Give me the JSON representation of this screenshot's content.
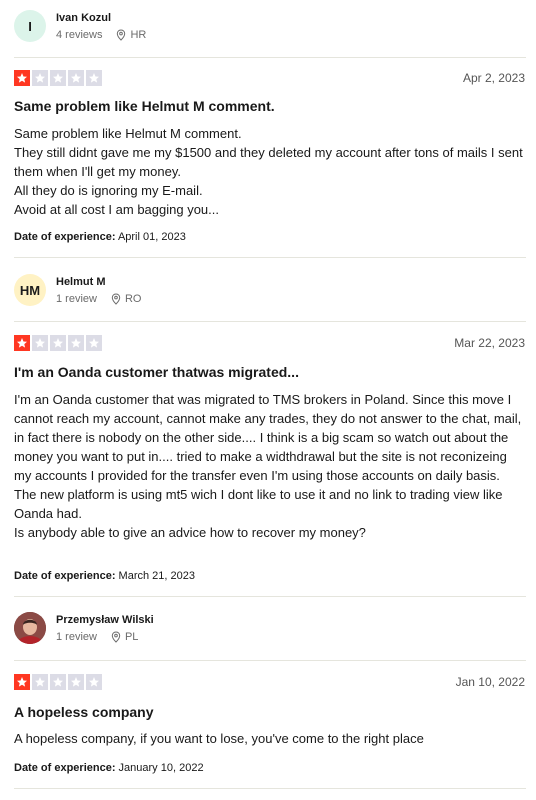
{
  "reviews": [
    {
      "avatar_initials": "I",
      "avatar_color": "#dcf4ea",
      "reviewer_name": "Ivan Kozul",
      "review_count": "4 reviews",
      "country": "HR",
      "rating": 1,
      "date": "Apr 2, 2023",
      "title": "Same problem like Helmut M comment.",
      "body": "Same problem like Helmut M comment.\nThey still didnt gave me my $1500 and they deleted my account after tons of mails I sent them when I'll get my money.\nAll they do is ignoring my E-mail.\nAvoid at all cost I am bagging you...",
      "experience_label": "Date of experience:",
      "experience_date": "April 01, 2023"
    },
    {
      "avatar_initials": "HM",
      "avatar_color": "#fff2c4",
      "reviewer_name": "Helmut M",
      "review_count": "1 review",
      "country": "RO",
      "rating": 1,
      "date": "Mar 22, 2023",
      "title": "I'm an Oanda customer thatwas migrated...",
      "body": "I'm an Oanda customer that was migrated to TMS brokers in Poland. Since this move I cannot reach my account, cannot make any trades, they do not answer to the chat, mail, in fact there is nobody on the other side.... I think is a big scam so watch out about the money you want to put in.... tried to make a widthdrawal but the site is not reconizeing my accounts I provided for the transfer even I'm using those accounts on daily basis.\nThe new platform is using mt5 wich I dont like to use it and no link to trading view like Oanda had.\nIs anybody able to give an advice how to recover my money?",
      "experience_label": "Date of experience:",
      "experience_date": "March 21, 2023"
    },
    {
      "avatar_initials": "",
      "reviewer_name": "Przemysław Wilski",
      "review_count": "1 review",
      "country": "PL",
      "rating": 1,
      "date": "Jan 10, 2022",
      "title": "A hopeless company",
      "body": "A hopeless company, if you want to lose, you've come to the right place",
      "experience_label": "Date of experience:",
      "experience_date": "January 10, 2022"
    }
  ],
  "colors": {
    "star_on": "#ff3722",
    "star_off": "#dcdce6"
  }
}
